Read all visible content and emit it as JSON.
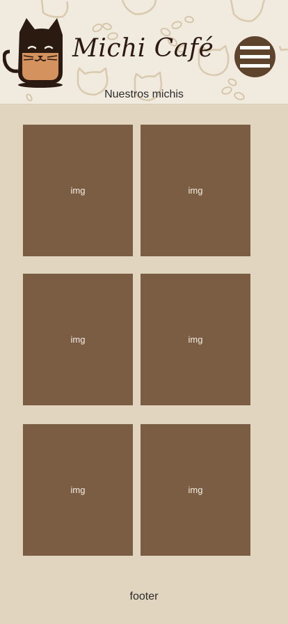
{
  "header": {
    "brand": "Michi Café",
    "subtitle": "Nuestros michis",
    "logo_icon": "cat-coffee-cup-icon",
    "menu_icon": "hamburger-menu-icon",
    "background_pattern": "cat-and-coffee-bean-pattern"
  },
  "gallery": {
    "items": [
      {
        "label": "img"
      },
      {
        "label": "img"
      },
      {
        "label": "img"
      },
      {
        "label": "img"
      },
      {
        "label": "img"
      },
      {
        "label": "img"
      }
    ]
  },
  "footer": {
    "text": "footer"
  },
  "colors": {
    "page_background": "#e1d5c0",
    "header_background": "#f1eadf",
    "tile": "#7a5d43",
    "menu_button": "#5e432d",
    "text": "#2b2b2b"
  }
}
